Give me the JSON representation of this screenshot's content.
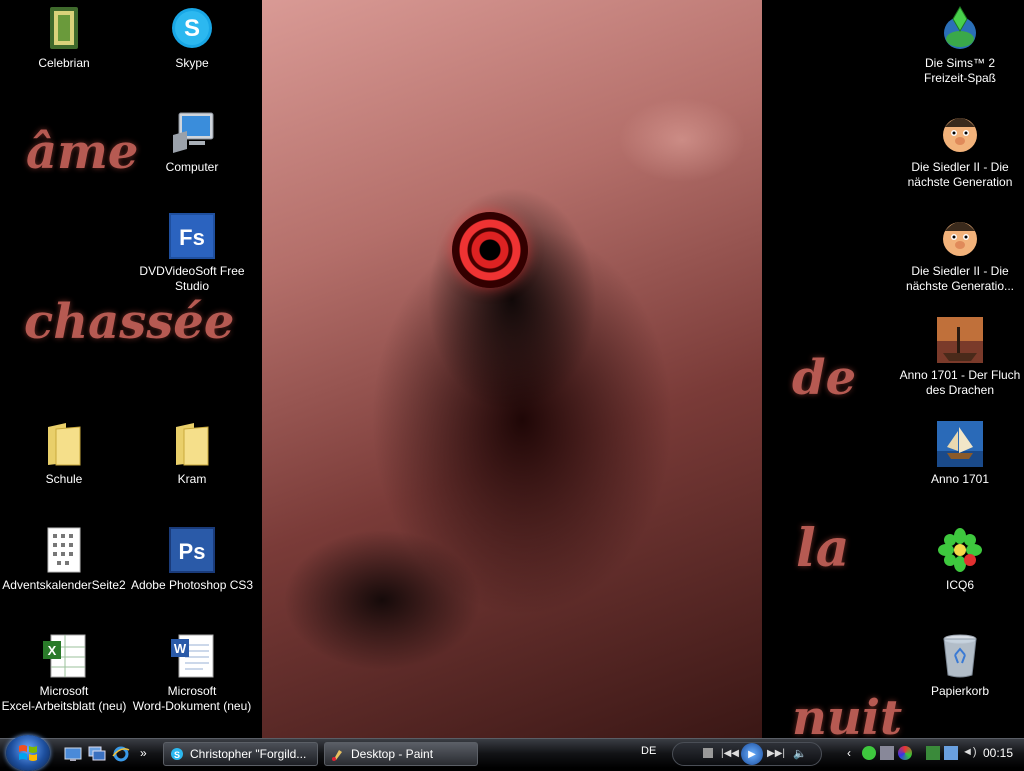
{
  "wallpaper": {
    "words": [
      "âme",
      "chassée",
      "de",
      "la",
      "nuit"
    ]
  },
  "desktop_icons": {
    "left_column_1": [
      {
        "label": "Celebrian",
        "icon": "book-icon"
      },
      {
        "label": "",
        "icon": "spacer"
      },
      {
        "label": "",
        "icon": "spacer"
      },
      {
        "label": "",
        "icon": "spacer"
      },
      {
        "label": "Schule",
        "icon": "folder-icon"
      },
      {
        "label": "AdventskalenderSeite2",
        "icon": "document-image-icon"
      },
      {
        "label": "Microsoft\nExcel-Arbeitsblatt (neu)",
        "icon": "excel-icon"
      }
    ],
    "left_column_2": [
      {
        "label": "Skype",
        "icon": "skype-icon"
      },
      {
        "label": "Computer",
        "icon": "computer-icon"
      },
      {
        "label": "DVDVideoSoft Free\nStudio",
        "icon": "fs-icon"
      },
      {
        "label": "",
        "icon": "spacer"
      },
      {
        "label": "Kram",
        "icon": "folder-icon"
      },
      {
        "label": "Adobe Photoshop CS3",
        "icon": "photoshop-icon"
      },
      {
        "label": "Microsoft\nWord-Dokument (neu)",
        "icon": "word-icon"
      }
    ],
    "right_column": [
      {
        "label": "Die Sims™ 2\nFreizeit-Spaß",
        "icon": "sims-icon"
      },
      {
        "label": "Die Siedler II - Die\nnächste Generation",
        "icon": "settler-icon"
      },
      {
        "label": "Die Siedler II - Die\nnächste Generatio...",
        "icon": "settler-icon"
      },
      {
        "label": "Anno 1701 - Der Fluch\ndes Drachen",
        "icon": "anno-dragon-icon"
      },
      {
        "label": "Anno 1701",
        "icon": "anno-icon"
      },
      {
        "label": "ICQ6",
        "icon": "icq-icon"
      },
      {
        "label": "Papierkorb",
        "icon": "recycle-bin-icon"
      }
    ]
  },
  "taskbar": {
    "buttons": [
      {
        "label": "Christopher \"Forgild...",
        "icon": "skype-icon"
      },
      {
        "label": "Desktop - Paint",
        "icon": "paint-icon"
      }
    ],
    "language": "DE",
    "clock": "00:15"
  },
  "colors": {
    "wallpaper_text": "#b65a52",
    "taskbar": "#121316"
  }
}
